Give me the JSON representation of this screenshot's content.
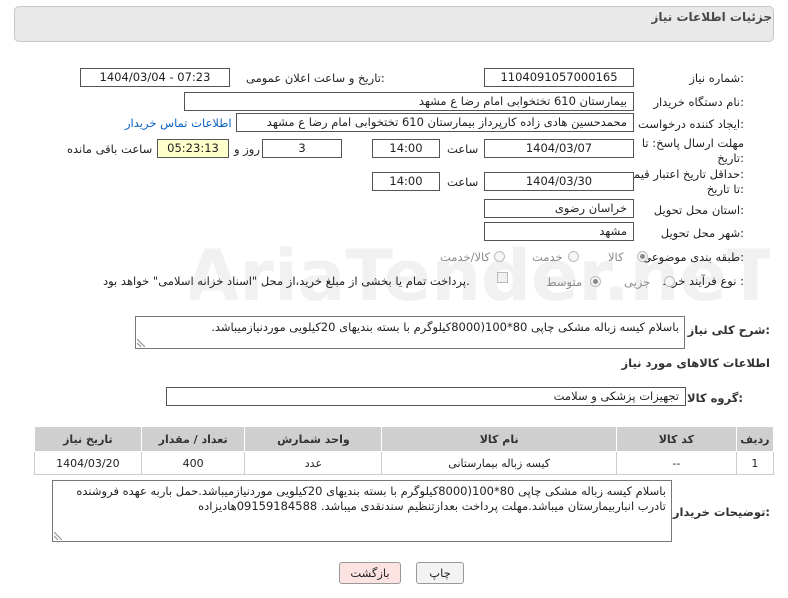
{
  "header": {
    "title": "جزئیات اطلاعات نیاز"
  },
  "fields": {
    "need_number_label": "شماره نیاز:",
    "need_number": "1104091057000165",
    "announce_label": "تاریخ و ساعت اعلان عمومی:",
    "announce_value": "1404/03/04 - 07:23",
    "buyer_org_label": "نام دستگاه خریدار:",
    "buyer_org": "بیمارستان 610 تختخوابی امام رضا ع  مشهد",
    "creator_label": "ایجاد کننده درخواست:",
    "creator": "محمدحسین هادی زاده کارپرداز بیمارستان 610 تختخوابی امام رضا ع  مشهد",
    "contact_link": "اطلاعات تماس خریدار",
    "deadline_label_1": "مهلت ارسال پاسخ: تا",
    "deadline_label_2": "تاریخ:",
    "deadline_date": "1404/03/07",
    "time_label": "ساعت",
    "deadline_time": "14:00",
    "days_value": "3",
    "days_label": "روز و",
    "remaining_time": "05:23:13",
    "remaining_label": "ساعت باقی مانده",
    "validity_label_1": "حداقل تاریخ اعتبار قیمت:",
    "validity_label_2": "تا تاریخ:",
    "validity_date": "1404/03/30",
    "validity_time": "14:00",
    "province_label": "استان محل تحویل:",
    "province": "خراسان رضوی",
    "city_label": "شهر محل تحویل:",
    "city": "مشهد",
    "category_label": "طبقه بندی موضوعی:",
    "category_options": [
      "کالا",
      "خدمت",
      "کالا/خدمت"
    ],
    "process_label": "نوع فرآیند خرید :",
    "process_options": [
      "جزیی",
      "متوسط"
    ],
    "payment_note": "پرداخت تمام یا بخشی از مبلغ خرید،از محل \"اسناد خزانه اسلامی\" خواهد بود."
  },
  "description": {
    "label": "شرح کلی نیاز:",
    "text": "باسلام کیسه زباله مشکی چاپی 80*100(8000کیلوگرم با بسته بندیهای 20کیلویی موردنیازمیباشد."
  },
  "goods_info": {
    "title": "اطلاعات کالاهای مورد نیاز"
  },
  "goods_group": {
    "label": "گروه کالا:",
    "value": "تجهیزات پزشکی و سلامت"
  },
  "table": {
    "headers": [
      "ردیف",
      "کد کالا",
      "نام کالا",
      "واحد شمارش",
      "تعداد / مقدار",
      "تاریخ نیاز"
    ],
    "rows": [
      [
        "1",
        "--",
        "کیسه زباله بیمارستانی",
        "عدد",
        "400",
        "1404/03/20"
      ]
    ]
  },
  "buyer_notes": {
    "label": "توضیحات خریدار:",
    "text": "باسلام کیسه زباله مشکی چاپی 80*100(8000کیلوگرم با بسته بندیهای 20کیلویی موردنیازمیباشد.حمل باربه عهده فروشنده تادرب انباربیمارستان میباشد.مهلت پرداخت بعدازتنظیم سندنقدی میباشد. 09159184588هادیزاده"
  },
  "buttons": {
    "print": "چاپ",
    "back": "بازگشت"
  },
  "watermark": "AriaTender.neT",
  "colors": {
    "link": "#0b62c4",
    "highlight_box": "#ffffcc",
    "back_button": "#fde2e2",
    "table_header": "#cfcfcf"
  }
}
